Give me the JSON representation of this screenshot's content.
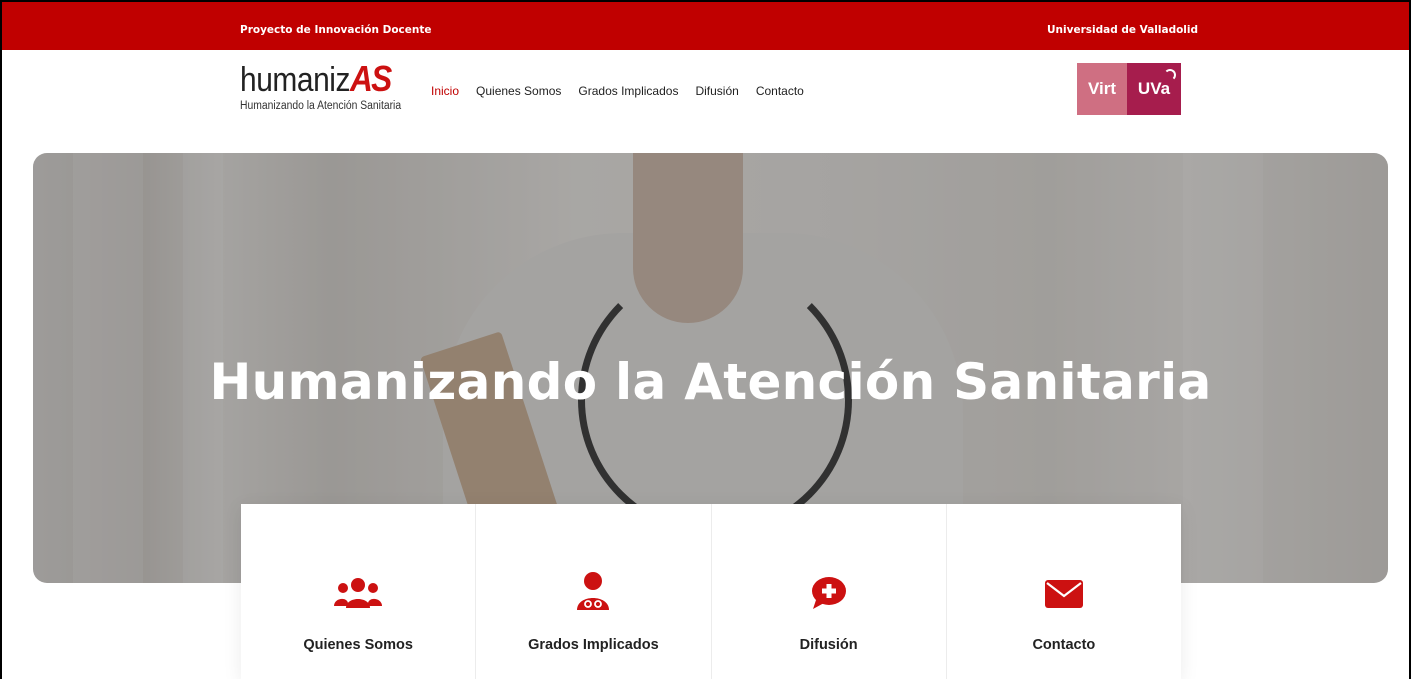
{
  "topbar": {
    "left_text": "Proyecto de Innovación Docente",
    "right_text": "Universidad de Valladolid"
  },
  "logo": {
    "main": "humaniz",
    "accent": "AS",
    "subtitle": "Humanizando la Atención Sanitaria"
  },
  "nav": {
    "items": [
      {
        "label": "Inicio",
        "active": true
      },
      {
        "label": "Quienes Somos",
        "active": false
      },
      {
        "label": "Grados Implicados",
        "active": false
      },
      {
        "label": "Difusión",
        "active": false
      },
      {
        "label": "Contacto",
        "active": false
      }
    ]
  },
  "partner_logo": {
    "left": "Virt",
    "right": "UVa"
  },
  "hero": {
    "title": "Humanizando la Atención Sanitaria"
  },
  "cards": [
    {
      "label": "Quienes Somos",
      "icon": "users-group-icon"
    },
    {
      "label": "Grados Implicados",
      "icon": "doctor-icon"
    },
    {
      "label": "Difusión",
      "icon": "medical-chat-icon"
    },
    {
      "label": "Contacto",
      "icon": "envelope-icon"
    }
  ],
  "colors": {
    "brand_red": "#c00000",
    "accent_red": "#cc1111"
  }
}
